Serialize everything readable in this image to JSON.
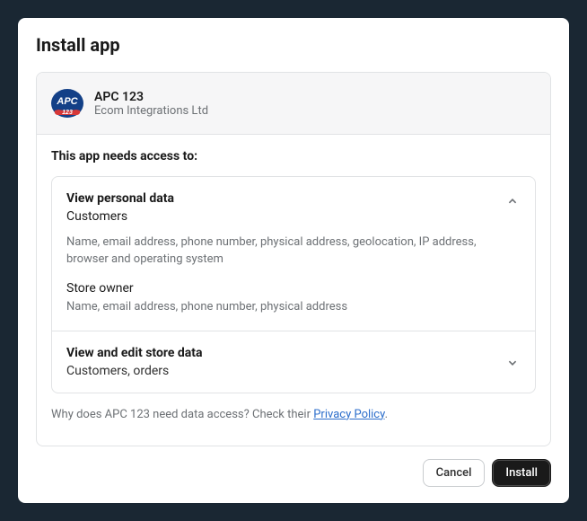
{
  "modal": {
    "title": "Install app"
  },
  "app": {
    "name": "APC 123",
    "vendor": "Ecom Integrations Ltd"
  },
  "access": {
    "heading": "This app needs access to:",
    "sections": [
      {
        "title": "View personal data",
        "summary": "Customers",
        "expanded": true,
        "groups": [
          {
            "name": "Customers",
            "detail": "Name, email address, phone number, physical address, geolocation, IP address, browser and operating system"
          },
          {
            "name": "Store owner",
            "detail": "Name, email address, phone number, physical address"
          }
        ]
      },
      {
        "title": "View and edit store data",
        "summary": "Customers, orders",
        "expanded": false
      }
    ]
  },
  "privacy": {
    "prefix": "Why does APC 123 need data access? Check their ",
    "link": "Privacy Policy",
    "suffix": "."
  },
  "buttons": {
    "cancel": "Cancel",
    "install": "Install"
  }
}
